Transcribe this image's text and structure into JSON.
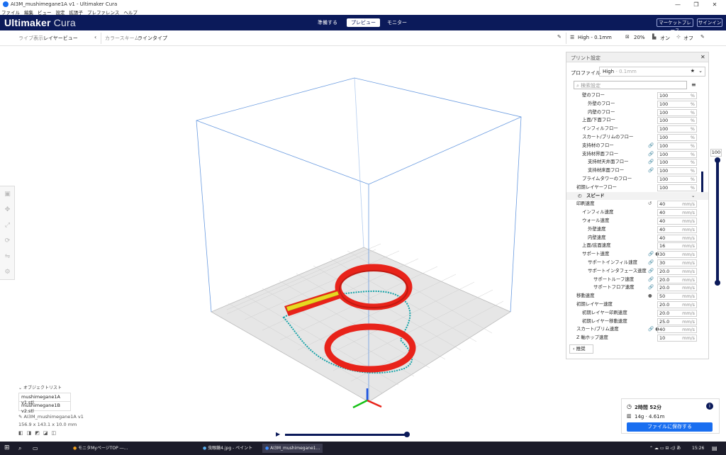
{
  "window": {
    "title": "AI3M_mushimegane1A v1 - Ultimaker Cura",
    "minimize": "—",
    "restore": "❐",
    "close": "✕"
  },
  "menu": [
    "ファイル",
    "編集",
    "ビュー",
    "設定",
    "拡張子",
    "プレファレンス",
    "ヘルプ"
  ],
  "header": {
    "logo_main": "Ultimaker",
    "logo_sub": " Cura",
    "stages": [
      {
        "label": "準備する",
        "active": false
      },
      {
        "label": "プレビュー",
        "active": true
      },
      {
        "label": "モニター",
        "active": false
      }
    ],
    "marketplace": "マーケットプレース",
    "signin": "サインイン"
  },
  "strip": {
    "view_type_label": "ライブ表示",
    "view_type_value": "レイヤービュー",
    "color_scheme_label": "カラースキーム",
    "color_scheme_value": "ラインタイプ",
    "profile": "High - 0.1mm",
    "infill": "20%",
    "support": "オン",
    "adhesion": "オフ"
  },
  "panel": {
    "title": "プリント設定",
    "profile_label": "プロファイル",
    "profile_value": "High",
    "profile_suffix": " - 0.1mm",
    "search_placeholder": "検索設定",
    "rows": [
      {
        "label": "壁のフロー",
        "indent": 1,
        "value": "100",
        "unit": "%",
        "icons": ""
      },
      {
        "label": "外壁のフロー",
        "indent": 2,
        "value": "100",
        "unit": "%",
        "icons": ""
      },
      {
        "label": "内壁のフロー",
        "indent": 2,
        "value": "100",
        "unit": "%",
        "icons": ""
      },
      {
        "label": "上面/下面フロー",
        "indent": 1,
        "value": "100",
        "unit": "%",
        "icons": ""
      },
      {
        "label": "インフィルフロー",
        "indent": 1,
        "value": "100",
        "unit": "%",
        "icons": ""
      },
      {
        "label": "スカート/ブリムのフロー",
        "indent": 1,
        "value": "100",
        "unit": "%",
        "icons": ""
      },
      {
        "label": "支持材のフロー",
        "indent": 1,
        "value": "100",
        "unit": "%",
        "icons": "🔗"
      },
      {
        "label": "支持材界面フロー",
        "indent": 1,
        "value": "100",
        "unit": "%",
        "icons": "🔗"
      },
      {
        "label": "支持材天井面フロー",
        "indent": 2,
        "value": "100",
        "unit": "%",
        "icons": "🔗"
      },
      {
        "label": "支持材床面フロー",
        "indent": 2,
        "value": "100",
        "unit": "%",
        "icons": "🔗"
      },
      {
        "label": "プライムタワーのフロー",
        "indent": 1,
        "value": "100",
        "unit": "%",
        "icons": ""
      },
      {
        "label": "初期レイヤーフロー",
        "indent": 0,
        "value": "100",
        "unit": "%",
        "icons": ""
      }
    ],
    "speed_header": "スピード",
    "speed_rows": [
      {
        "label": "印刷速度",
        "indent": 0,
        "value": "40",
        "unit": "mm/s",
        "icons": "↺"
      },
      {
        "label": "インフィル速度",
        "indent": 1,
        "value": "40",
        "unit": "mm/s",
        "icons": ""
      },
      {
        "label": "ウォール速度",
        "indent": 1,
        "value": "40",
        "unit": "mm/s",
        "icons": ""
      },
      {
        "label": "外壁速度",
        "indent": 2,
        "value": "40",
        "unit": "mm/s",
        "icons": ""
      },
      {
        "label": "内壁速度",
        "indent": 2,
        "value": "40",
        "unit": "mm/s",
        "icons": ""
      },
      {
        "label": "上面/底面速度",
        "indent": 1,
        "value": "16",
        "unit": "mm/s",
        "icons": ""
      },
      {
        "label": "サポート速度",
        "indent": 1,
        "value": "30",
        "unit": "mm/s",
        "icons": "🔗 ●"
      },
      {
        "label": "サポートインフィル速度",
        "indent": 2,
        "value": "30",
        "unit": "mm/s",
        "icons": "🔗"
      },
      {
        "label": "サポートインタフェース速度",
        "indent": 2,
        "value": "20.0",
        "unit": "mm/s",
        "icons": "🔗"
      },
      {
        "label": "サポートルーフ速度",
        "indent": 3,
        "value": "20.0",
        "unit": "mm/s",
        "icons": "🔗"
      },
      {
        "label": "サポートフロア速度",
        "indent": 3,
        "value": "20.0",
        "unit": "mm/s",
        "icons": "🔗"
      },
      {
        "label": "移動速度",
        "indent": 0,
        "value": "50",
        "unit": "mm/s",
        "icons": "●"
      },
      {
        "label": "初期レイヤー速度",
        "indent": 0,
        "value": "20.0",
        "unit": "mm/s",
        "icons": ""
      },
      {
        "label": "初期レイヤー印刷速度",
        "indent": 1,
        "value": "20.0",
        "unit": "mm/s",
        "icons": ""
      },
      {
        "label": "初期レイヤー移動速度",
        "indent": 1,
        "value": "25.0",
        "unit": "mm/s",
        "icons": ""
      },
      {
        "label": "スカート/ブリム速度",
        "indent": 0,
        "value": "40",
        "unit": "mm/s",
        "icons": "🔗 ●"
      },
      {
        "label": "Z 軸ホップ速度",
        "indent": 0,
        "value": "10",
        "unit": "mm/s",
        "icons": ""
      }
    ],
    "recommended_button": "推奨"
  },
  "layer_slider": {
    "value": "100"
  },
  "objects": {
    "header": "オブジェクトリスト",
    "items": [
      "mushimegane1A v1.stl",
      "mushimegane1B v2.stl"
    ],
    "current_name": "AI3M_mushimegane1A v1",
    "dimensions": "156.9 x 143.1 x 10.0 mm"
  },
  "print": {
    "time": "2時間 52分",
    "material": "14g · 4.61m",
    "save_button": "ファイルに保存する"
  },
  "taskbar": {
    "items": [
      "モニタMyページTOP ―...",
      "虫眼鏡4.jpg - ペイント",
      "AI3M_mushimegane1..."
    ],
    "time": "15:26"
  },
  "colors": {
    "header": "#0b1a5a",
    "accent": "#196ef0",
    "model": "#e8231a",
    "skirt": "#15a3a8",
    "grid": "#d9d9d9"
  }
}
